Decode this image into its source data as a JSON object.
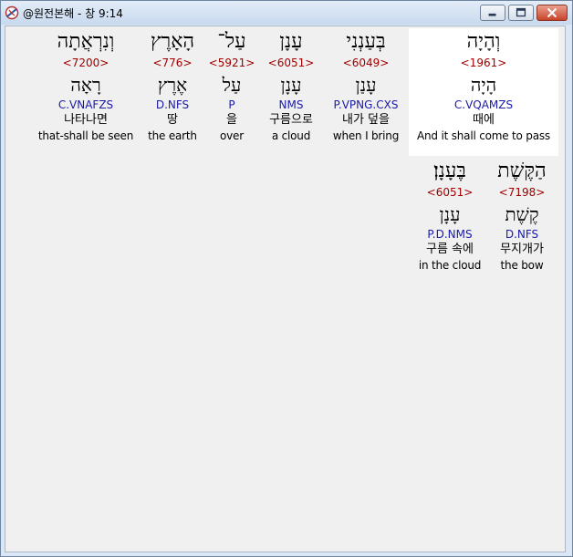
{
  "window": {
    "title": "@원전본해 - 창 9:14"
  },
  "verse": {
    "words": [
      {
        "hebrew": "וְהָיָה",
        "strong": "<1961>",
        "lemma": "הָיָה",
        "morph": "C.VQAMZS",
        "korean": "때에",
        "english": "And it shall come to pass",
        "highlighted": true
      },
      {
        "hebrew": "בְּעַנְנִי",
        "strong": "<6049>",
        "lemma": "עָנַן",
        "morph": "P.VPNG.CXS",
        "korean": "내가 덮을",
        "english": "when I bring",
        "highlighted": false
      },
      {
        "hebrew": "עָנָן",
        "strong": "<6051>",
        "lemma": "עָנָן",
        "morph": "NMS",
        "korean": "구름으로",
        "english": "a cloud",
        "highlighted": false
      },
      {
        "hebrew": "עַל־",
        "strong": "<5921>",
        "lemma": "עַל",
        "morph": "P",
        "korean": "을",
        "english": "over",
        "highlighted": false
      },
      {
        "hebrew": "הָאָרֶץ",
        "strong": "<776>",
        "lemma": "אֶרֶץ",
        "morph": "D.NFS",
        "korean": "땅",
        "english": "the earth",
        "highlighted": false
      },
      {
        "hebrew": "וְנִרְאֲתָה",
        "strong": "<7200>",
        "lemma": "רָאָה",
        "morph": "C.VNAFZS",
        "korean": "나타나면",
        "english": "that-shall be seen",
        "highlighted": false
      },
      {
        "hebrew": "הַקֶּשֶׁת",
        "strong": "<7198>",
        "lemma": "קֶשֶׁת",
        "morph": "D.NFS",
        "korean": "무지개가",
        "english": "the bow",
        "highlighted": false
      },
      {
        "hebrew": "בֶּעָנָן׃",
        "strong": "<6051>",
        "lemma": "עָנָן",
        "morph": "P.D.NMS",
        "korean": "구름 속에",
        "english": "in the cloud",
        "highlighted": false
      }
    ]
  }
}
